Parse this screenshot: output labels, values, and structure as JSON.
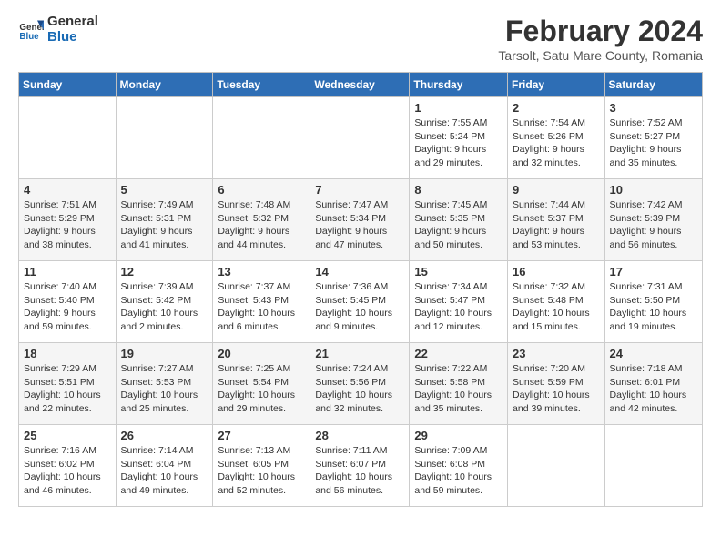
{
  "logo": {
    "line1": "General",
    "line2": "Blue"
  },
  "title": "February 2024",
  "subtitle": "Tarsolt, Satu Mare County, Romania",
  "days_header": [
    "Sunday",
    "Monday",
    "Tuesday",
    "Wednesday",
    "Thursday",
    "Friday",
    "Saturday"
  ],
  "weeks": [
    [
      {
        "day": "",
        "info": ""
      },
      {
        "day": "",
        "info": ""
      },
      {
        "day": "",
        "info": ""
      },
      {
        "day": "",
        "info": ""
      },
      {
        "day": "1",
        "info": "Sunrise: 7:55 AM\nSunset: 5:24 PM\nDaylight: 9 hours\nand 29 minutes."
      },
      {
        "day": "2",
        "info": "Sunrise: 7:54 AM\nSunset: 5:26 PM\nDaylight: 9 hours\nand 32 minutes."
      },
      {
        "day": "3",
        "info": "Sunrise: 7:52 AM\nSunset: 5:27 PM\nDaylight: 9 hours\nand 35 minutes."
      }
    ],
    [
      {
        "day": "4",
        "info": "Sunrise: 7:51 AM\nSunset: 5:29 PM\nDaylight: 9 hours\nand 38 minutes."
      },
      {
        "day": "5",
        "info": "Sunrise: 7:49 AM\nSunset: 5:31 PM\nDaylight: 9 hours\nand 41 minutes."
      },
      {
        "day": "6",
        "info": "Sunrise: 7:48 AM\nSunset: 5:32 PM\nDaylight: 9 hours\nand 44 minutes."
      },
      {
        "day": "7",
        "info": "Sunrise: 7:47 AM\nSunset: 5:34 PM\nDaylight: 9 hours\nand 47 minutes."
      },
      {
        "day": "8",
        "info": "Sunrise: 7:45 AM\nSunset: 5:35 PM\nDaylight: 9 hours\nand 50 minutes."
      },
      {
        "day": "9",
        "info": "Sunrise: 7:44 AM\nSunset: 5:37 PM\nDaylight: 9 hours\nand 53 minutes."
      },
      {
        "day": "10",
        "info": "Sunrise: 7:42 AM\nSunset: 5:39 PM\nDaylight: 9 hours\nand 56 minutes."
      }
    ],
    [
      {
        "day": "11",
        "info": "Sunrise: 7:40 AM\nSunset: 5:40 PM\nDaylight: 9 hours\nand 59 minutes."
      },
      {
        "day": "12",
        "info": "Sunrise: 7:39 AM\nSunset: 5:42 PM\nDaylight: 10 hours\nand 2 minutes."
      },
      {
        "day": "13",
        "info": "Sunrise: 7:37 AM\nSunset: 5:43 PM\nDaylight: 10 hours\nand 6 minutes."
      },
      {
        "day": "14",
        "info": "Sunrise: 7:36 AM\nSunset: 5:45 PM\nDaylight: 10 hours\nand 9 minutes."
      },
      {
        "day": "15",
        "info": "Sunrise: 7:34 AM\nSunset: 5:47 PM\nDaylight: 10 hours\nand 12 minutes."
      },
      {
        "day": "16",
        "info": "Sunrise: 7:32 AM\nSunset: 5:48 PM\nDaylight: 10 hours\nand 15 minutes."
      },
      {
        "day": "17",
        "info": "Sunrise: 7:31 AM\nSunset: 5:50 PM\nDaylight: 10 hours\nand 19 minutes."
      }
    ],
    [
      {
        "day": "18",
        "info": "Sunrise: 7:29 AM\nSunset: 5:51 PM\nDaylight: 10 hours\nand 22 minutes."
      },
      {
        "day": "19",
        "info": "Sunrise: 7:27 AM\nSunset: 5:53 PM\nDaylight: 10 hours\nand 25 minutes."
      },
      {
        "day": "20",
        "info": "Sunrise: 7:25 AM\nSunset: 5:54 PM\nDaylight: 10 hours\nand 29 minutes."
      },
      {
        "day": "21",
        "info": "Sunrise: 7:24 AM\nSunset: 5:56 PM\nDaylight: 10 hours\nand 32 minutes."
      },
      {
        "day": "22",
        "info": "Sunrise: 7:22 AM\nSunset: 5:58 PM\nDaylight: 10 hours\nand 35 minutes."
      },
      {
        "day": "23",
        "info": "Sunrise: 7:20 AM\nSunset: 5:59 PM\nDaylight: 10 hours\nand 39 minutes."
      },
      {
        "day": "24",
        "info": "Sunrise: 7:18 AM\nSunset: 6:01 PM\nDaylight: 10 hours\nand 42 minutes."
      }
    ],
    [
      {
        "day": "25",
        "info": "Sunrise: 7:16 AM\nSunset: 6:02 PM\nDaylight: 10 hours\nand 46 minutes."
      },
      {
        "day": "26",
        "info": "Sunrise: 7:14 AM\nSunset: 6:04 PM\nDaylight: 10 hours\nand 49 minutes."
      },
      {
        "day": "27",
        "info": "Sunrise: 7:13 AM\nSunset: 6:05 PM\nDaylight: 10 hours\nand 52 minutes."
      },
      {
        "day": "28",
        "info": "Sunrise: 7:11 AM\nSunset: 6:07 PM\nDaylight: 10 hours\nand 56 minutes."
      },
      {
        "day": "29",
        "info": "Sunrise: 7:09 AM\nSunset: 6:08 PM\nDaylight: 10 hours\nand 59 minutes."
      },
      {
        "day": "",
        "info": ""
      },
      {
        "day": "",
        "info": ""
      }
    ]
  ]
}
